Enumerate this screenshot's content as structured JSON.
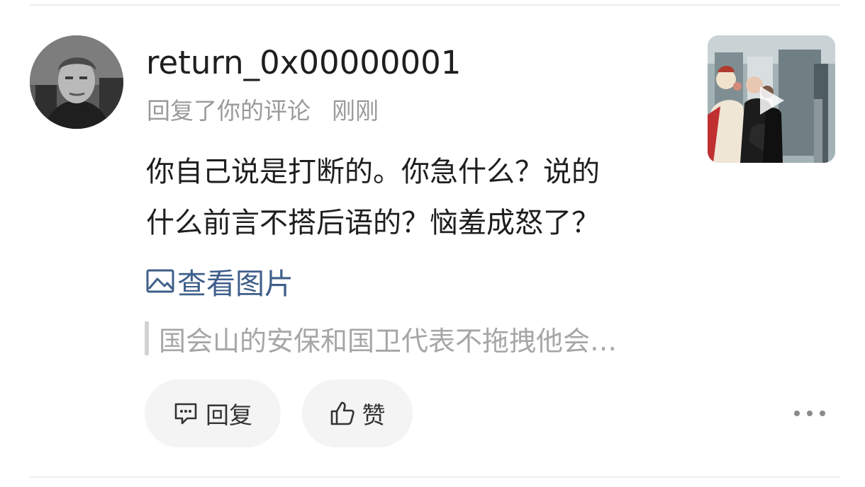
{
  "notification": {
    "username": "return_0x00000001",
    "action": "回复了你的评论",
    "time": "刚刚",
    "comment_lines": [
      "你自己说是打断的。你急什么？说的",
      "什么前言不搭后语的？恼羞成怒了？"
    ],
    "view_images_label": "查看图片",
    "quoted_text": "国会山的安保和国卫代表不拖拽他会…",
    "reply_label": "回复",
    "like_label": "赞"
  },
  "colors": {
    "link": "#3f5f8a",
    "secondary_text": "#9a9a9a",
    "pill_background": "#f4f4f4"
  },
  "icons": {
    "avatar": "user-avatar-photo",
    "view_images": "image-icon",
    "reply": "comment-bubble-icon",
    "like": "thumbs-up-icon",
    "more": "more-dots-icon",
    "thumbnail": "video-thumbnail",
    "play": "play-icon"
  }
}
